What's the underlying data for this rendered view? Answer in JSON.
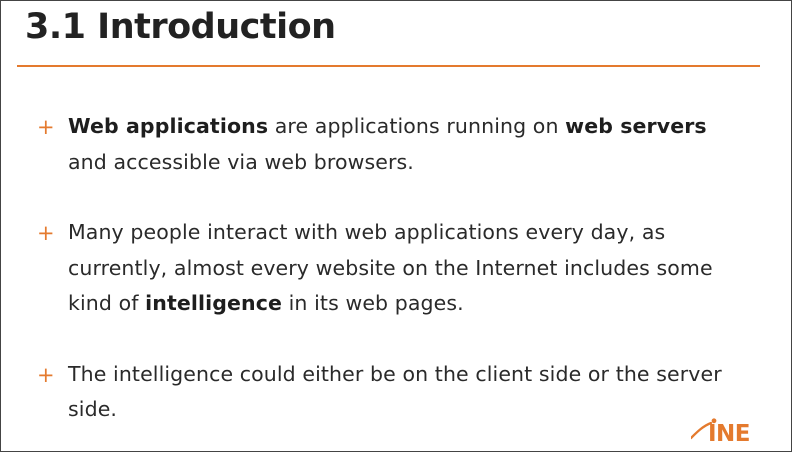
{
  "slide": {
    "title": "3.1 Introduction",
    "bullets": [
      {
        "marker": "+",
        "parts": [
          {
            "text": "Web applications",
            "bold": true
          },
          {
            "text": " are applications running on ",
            "bold": false
          },
          {
            "text": "web servers",
            "bold": true
          },
          {
            "text": " and accessible via web browsers.",
            "bold": false
          }
        ]
      },
      {
        "marker": "+",
        "parts": [
          {
            "text": "Many people interact with web applications every day, as currently, almost every website on the Internet includes some kind of ",
            "bold": false
          },
          {
            "text": "intelligence",
            "bold": true
          },
          {
            "text": " in its web pages.",
            "bold": false
          }
        ]
      },
      {
        "marker": "+",
        "parts": [
          {
            "text": "The intelligence could either be on the client side or the server side.",
            "bold": false
          }
        ]
      }
    ]
  },
  "logo": {
    "text": "INE",
    "icon": "ine-logo-icon"
  },
  "colors": {
    "accent": "#e47a2e",
    "text": "#2a2a2a",
    "title": "#222222",
    "border": "#444444"
  }
}
